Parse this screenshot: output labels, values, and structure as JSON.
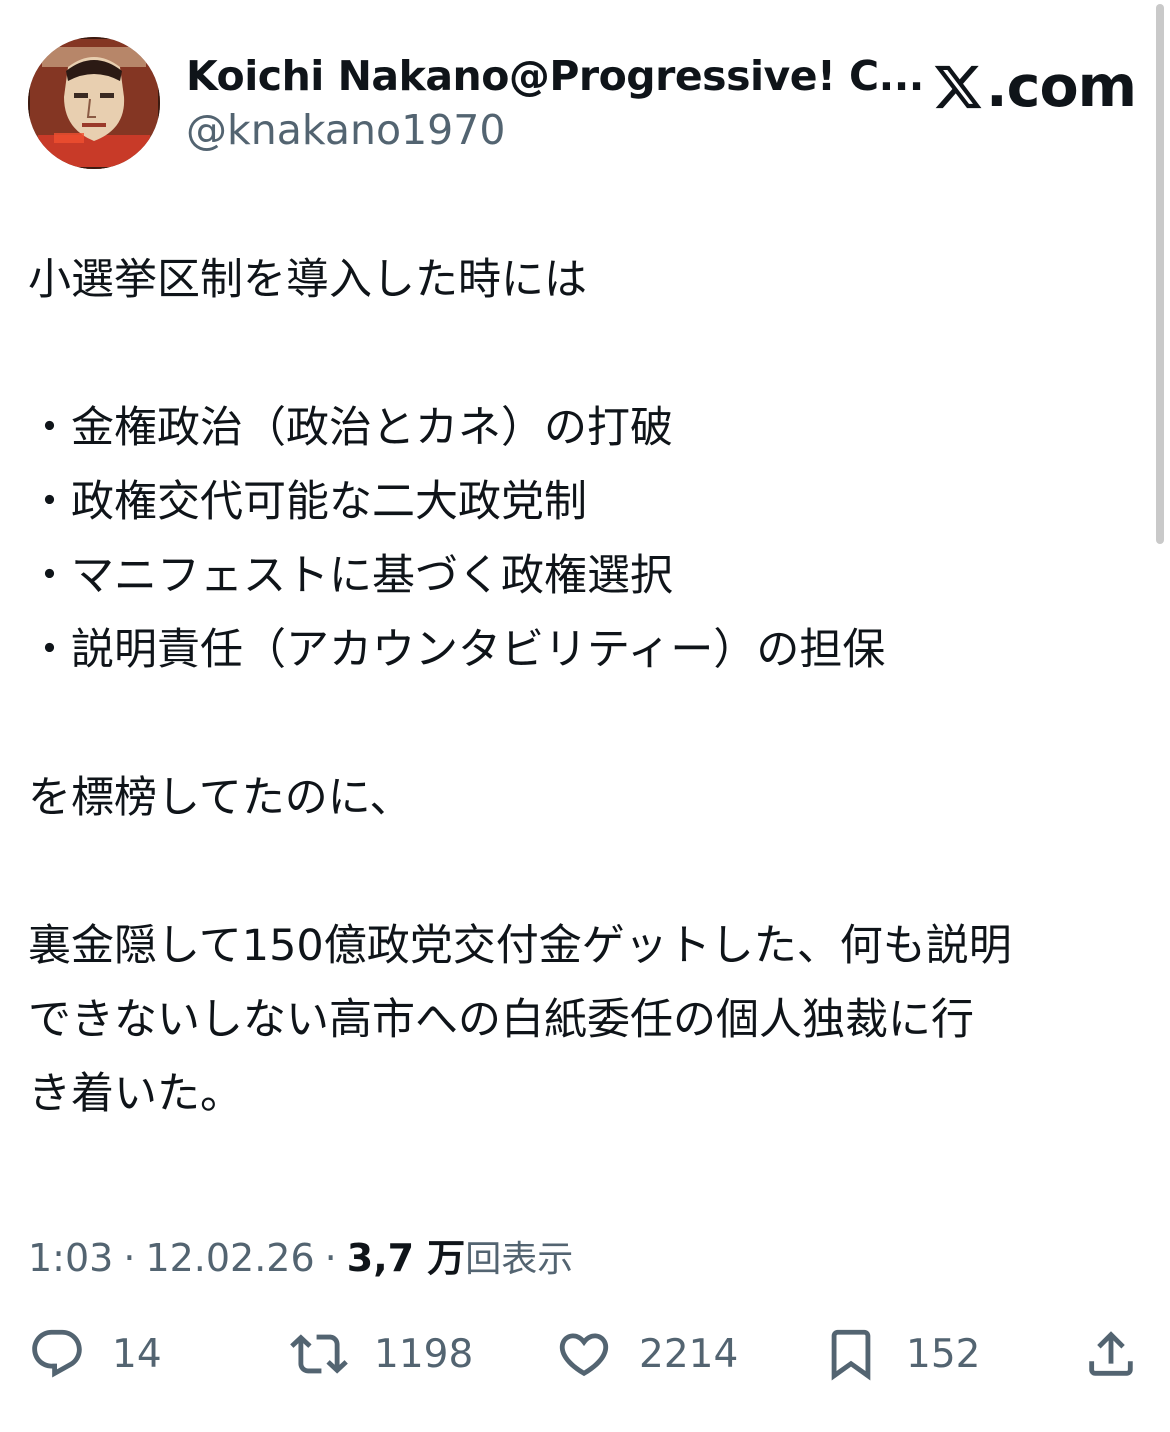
{
  "tweet": {
    "author": {
      "name": "Koichi Nakano@Progressive! C...",
      "handle": "@knakano1970"
    },
    "brand": "X.com",
    "lines": [
      "小選挙区制を導入した時には",
      "",
      "・金権政治（政治とカネ）の打破",
      "・政権交代可能な二大政党制",
      "・マニフェストに基づく政権選択",
      "・説明責任（アカウンタビリティー）の担保",
      "",
      "を標榜してたのに、",
      "",
      "裏金隠して150億政党交付金ゲットした、何も説明",
      "できないしない高市への白紙委任の個人独裁に行",
      "き着いた。"
    ],
    "time": "1:03",
    "date": "12.02.26",
    "views_count": "3,7 万",
    "views_label": "回表示",
    "actions": {
      "replies": "14",
      "reposts": "1198",
      "likes": "2214",
      "bookmarks": "152"
    }
  },
  "colors": {
    "text": "#0f1419",
    "secondary": "#536471",
    "background": "#ffffff"
  },
  "icons": [
    "x-logo-icon",
    "reply-icon",
    "repost-icon",
    "like-icon",
    "bookmark-icon",
    "share-icon"
  ]
}
